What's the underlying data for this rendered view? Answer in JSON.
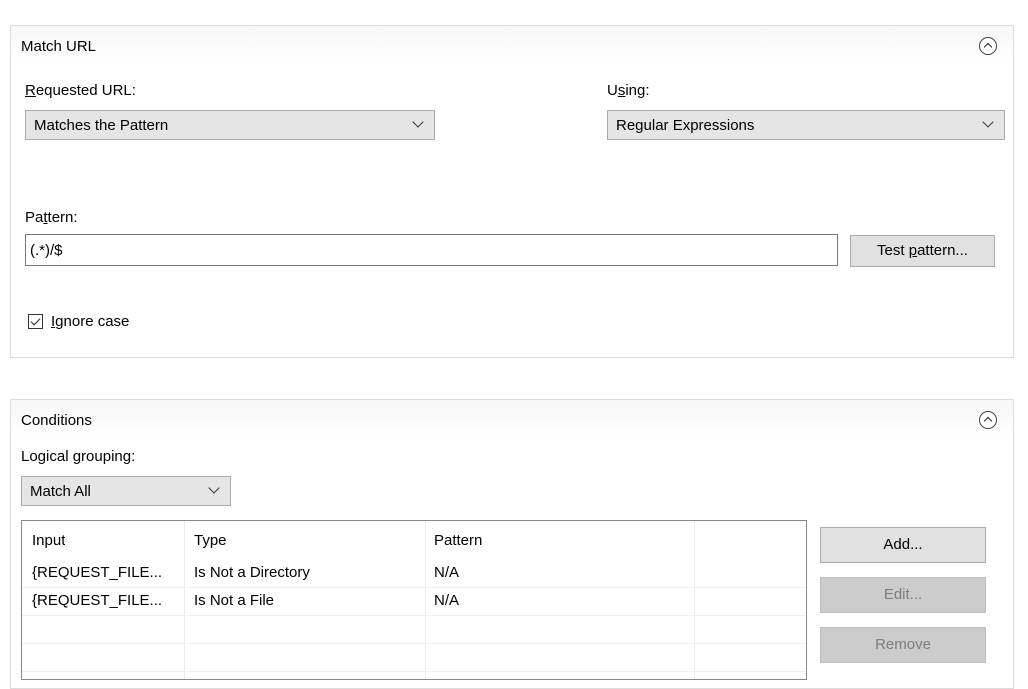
{
  "match_url": {
    "title": "Match URL",
    "requested_url_label": {
      "mn": "R",
      "rest": "equested URL:"
    },
    "requested_url_value": "Matches the Pattern",
    "using_label": {
      "pre": "U",
      "mn": "s",
      "rest": "ing:"
    },
    "using_value": "Regular Expressions",
    "pattern_label": {
      "pre": "Pa",
      "mn": "t",
      "rest": "tern:"
    },
    "pattern_value": "(.*)/$",
    "test_pattern_button": {
      "pre": "Test ",
      "mn": "p",
      "rest": "attern..."
    },
    "ignore_case": {
      "checked": true,
      "mn": "I",
      "rest": "gnore case"
    }
  },
  "conditions": {
    "title": "Conditions",
    "logical_grouping_label": {
      "pre": "Logical ",
      "mn": "g",
      "rest": "rouping:"
    },
    "logical_grouping_value": "Match All",
    "columns": [
      "Input",
      "Type",
      "Pattern",
      ""
    ],
    "rows": [
      [
        "{REQUEST_FILE...",
        "Is Not a Directory",
        "N/A",
        ""
      ],
      [
        "{REQUEST_FILE...",
        "Is Not a File",
        "N/A",
        ""
      ]
    ],
    "buttons": {
      "add": "Add...",
      "edit": "Edit...",
      "remove": "Remove"
    }
  }
}
